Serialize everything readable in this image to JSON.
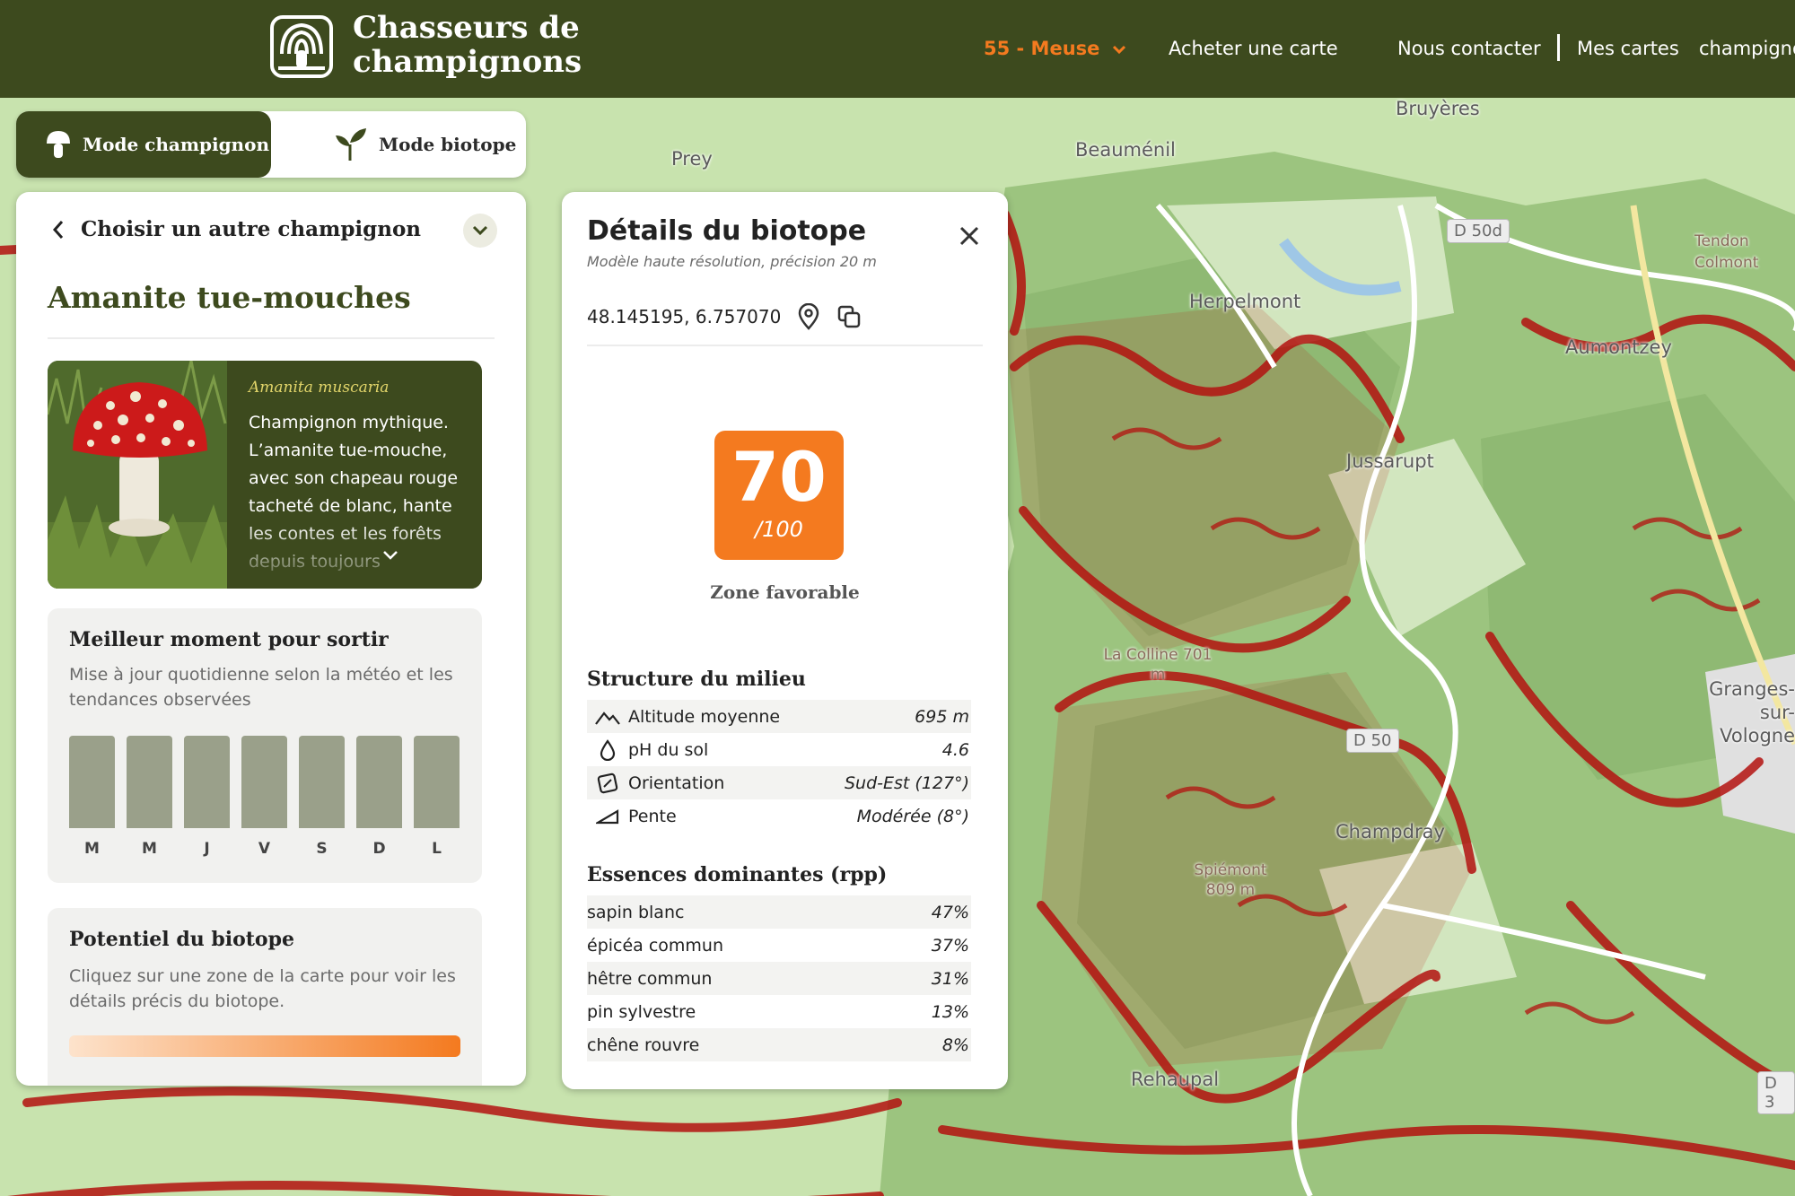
{
  "header": {
    "brand_line1": "Chasseurs de",
    "brand_line2": "champignons",
    "region": "55 - Meuse",
    "nav": [
      "Acheter une carte",
      "Nous contacter",
      "Mes cartes",
      "champignons"
    ]
  },
  "modes": {
    "active": "Mode champignon",
    "inactive": "Mode biotope"
  },
  "left_panel": {
    "back_label": "Choisir un autre champignon",
    "species_name": "Amanite tue-mouches",
    "latin_name": "Amanita muscaria",
    "description": "Champignon mythique. L’amanite tue-mouche, avec son chapeau rouge tacheté de blanc, hante les contes et les forêts depuis toujours",
    "best_time": {
      "title": "Meilleur moment pour sortir",
      "subtitle": "Mise à jour quotidienne selon la météo et les tendances observées",
      "days": [
        "M",
        "M",
        "J",
        "V",
        "S",
        "D",
        "L"
      ]
    },
    "potential": {
      "title": "Potentiel du biotope",
      "subtitle": "Cliquez sur une zone de la carte pour voir les détails précis du biotope."
    }
  },
  "detail_panel": {
    "title": "Détails du biotope",
    "subtitle": "Modèle haute résolution, précision 20 m",
    "coordinates": "48.145195, 6.757070",
    "score": "70",
    "score_max": "/100",
    "score_label": "Zone favorable",
    "structure_title": "Structure du milieu",
    "structure": [
      {
        "icon": "mountain-icon",
        "label": "Altitude moyenne",
        "value": "695 m"
      },
      {
        "icon": "drop-icon",
        "label": "pH du sol",
        "value": "4.6"
      },
      {
        "icon": "compass-icon",
        "label": "Orientation",
        "value": "Sud-Est (127°)"
      },
      {
        "icon": "slope-icon",
        "label": "Pente",
        "value": "Modérée (8°)"
      }
    ],
    "species_title": "Essences dominantes (rpp)",
    "species": [
      {
        "label": "sapin blanc",
        "value": "47%"
      },
      {
        "label": "épicéa commun",
        "value": "37%"
      },
      {
        "label": "hêtre commun",
        "value": "31%"
      },
      {
        "label": "pin sylvestre",
        "value": "13%"
      },
      {
        "label": "chêne rouvre",
        "value": "8%"
      }
    ]
  },
  "map": {
    "labels": [
      "Bruyères",
      "Beauménil",
      "Prey",
      "Herpelmont",
      "Aumontzey",
      "Jussarupt",
      "Champdray",
      "Rehaupal",
      "Granges-sur-Vologne",
      "Tendon Colmont"
    ],
    "minor_labels": [
      "La Colline 701 m",
      "Spiémont 809 m"
    ],
    "roads": [
      "D 50d",
      "D 50",
      "D 3"
    ],
    "colors": {
      "forest": "#9cc47f",
      "meadow": "#c8e3ae",
      "hotspot": "#b3120f",
      "accent": "#f47a1f",
      "brand": "#3d4a1e"
    }
  }
}
